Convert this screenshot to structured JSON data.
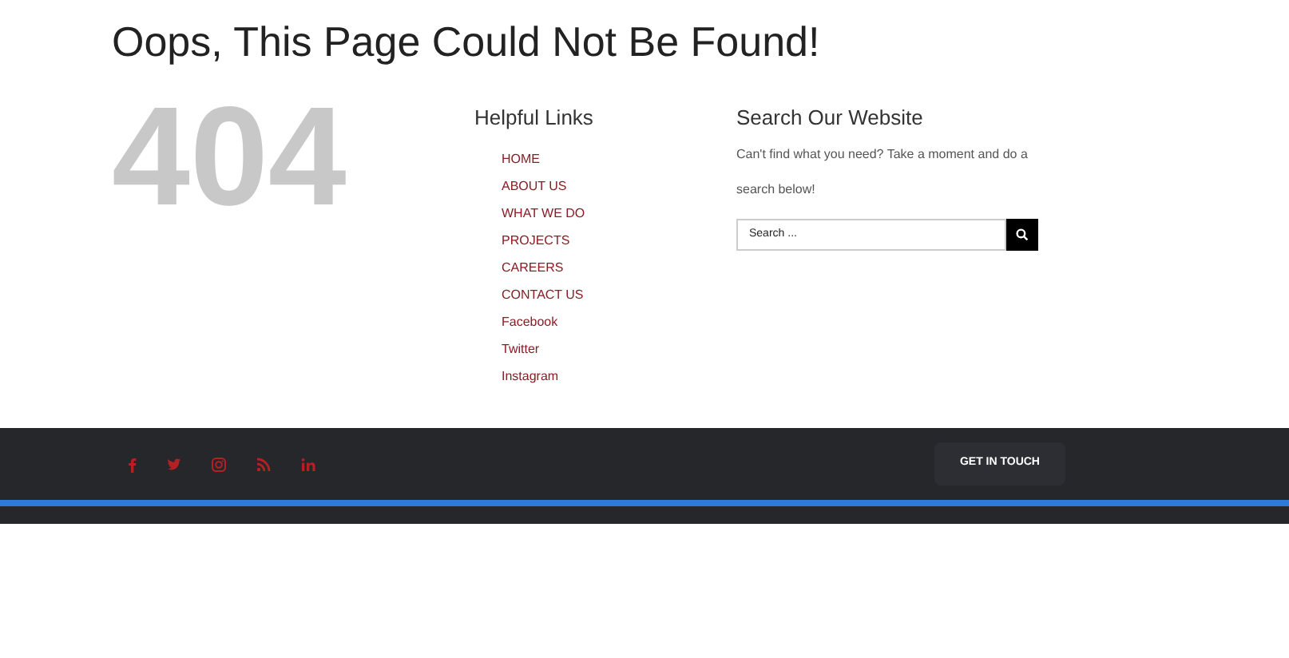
{
  "heading": "Oops, This Page Could Not Be Found!",
  "error_code": "404",
  "helpful_links": {
    "title": "Helpful Links",
    "items": [
      "HOME",
      "ABOUT US",
      "WHAT WE DO",
      "PROJECTS",
      "CAREERS",
      "CONTACT US",
      "Facebook",
      "Twitter",
      "Instagram"
    ]
  },
  "search": {
    "title": "Search Our Website",
    "text": "Can't find what you need? Take a moment and do a search below!",
    "placeholder": "Search ..."
  },
  "footer": {
    "social": [
      {
        "kind": "facebook"
      },
      {
        "kind": "twitter"
      },
      {
        "kind": "instagram"
      },
      {
        "kind": "rss"
      },
      {
        "kind": "linkedin"
      }
    ],
    "button": "GET IN TOUCH"
  }
}
